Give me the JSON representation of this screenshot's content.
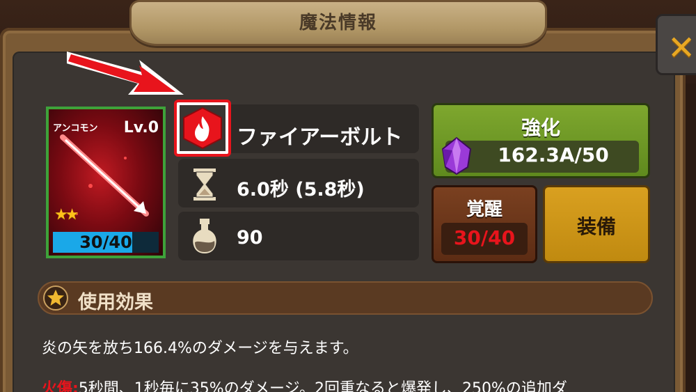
{
  "title": "魔法情報",
  "close_icon": "close-x-icon",
  "card": {
    "rarity": "アンコモン",
    "level": "Lv.0",
    "stars": "★★",
    "progress": "30/40",
    "progress_fraction": 0.75
  },
  "skill": {
    "name": "ファイアーボルト",
    "icon": "fire-icon",
    "cooldown": "6.0秒 (5.8秒)",
    "cooldown_icon": "hourglass-icon",
    "mana": "90",
    "mana_icon": "potion-icon"
  },
  "upgrade": {
    "label": "強化",
    "value": "162.3A/50",
    "icon": "purple-crystal-icon"
  },
  "awaken": {
    "label": "覚醒",
    "value": "30/40"
  },
  "equip": {
    "label": "装備"
  },
  "effect": {
    "header": "使用効果",
    "description": "炎の矢を放ち166.4%のダメージを与えます。",
    "burn_key": "火傷:",
    "burn_text": "5秒間、1秒毎に35%のダメージ。2回重なると爆発し、250%の追加ダ"
  },
  "colors": {
    "highlight": "#e8141c",
    "upgrade_green": "#6a9626",
    "equip_gold": "#d9a020",
    "awaken_brown": "#6a3418"
  }
}
